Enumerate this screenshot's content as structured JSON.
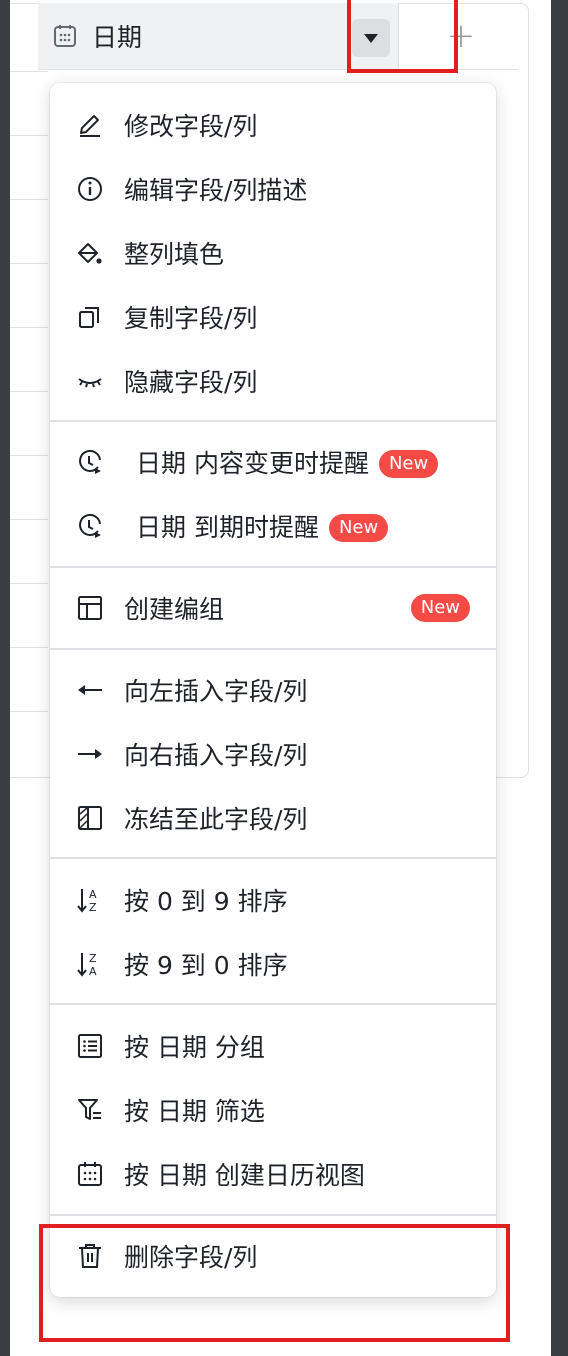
{
  "header": {
    "column_title": "日期",
    "add_column_symbol": "+"
  },
  "menu": {
    "edit_field": "修改字段/列",
    "edit_description": "编辑字段/列描述",
    "fill_color": "整列填色",
    "copy_field": "复制字段/列",
    "hide_field": "隐藏字段/列",
    "remind_on_change": "日期  内容变更时提醒",
    "remind_on_due": "日期  到期时提醒",
    "create_group": "创建编组",
    "insert_left": "向左插入字段/列",
    "insert_right": "向右插入字段/列",
    "freeze_to_here": "冻结至此字段/列",
    "sort_asc": "按 0 到 9 排序",
    "sort_desc": "按 9 到 0 排序",
    "group_by": "按  日期  分组",
    "filter_by": "按  日期  筛选",
    "create_calendar_view": "按  日期  创建日历视图",
    "delete_field": "删除字段/列",
    "new_badge": "New"
  },
  "colors": {
    "highlight_box": "#e02020",
    "badge": "#f54a45",
    "text": "#1f2329"
  }
}
